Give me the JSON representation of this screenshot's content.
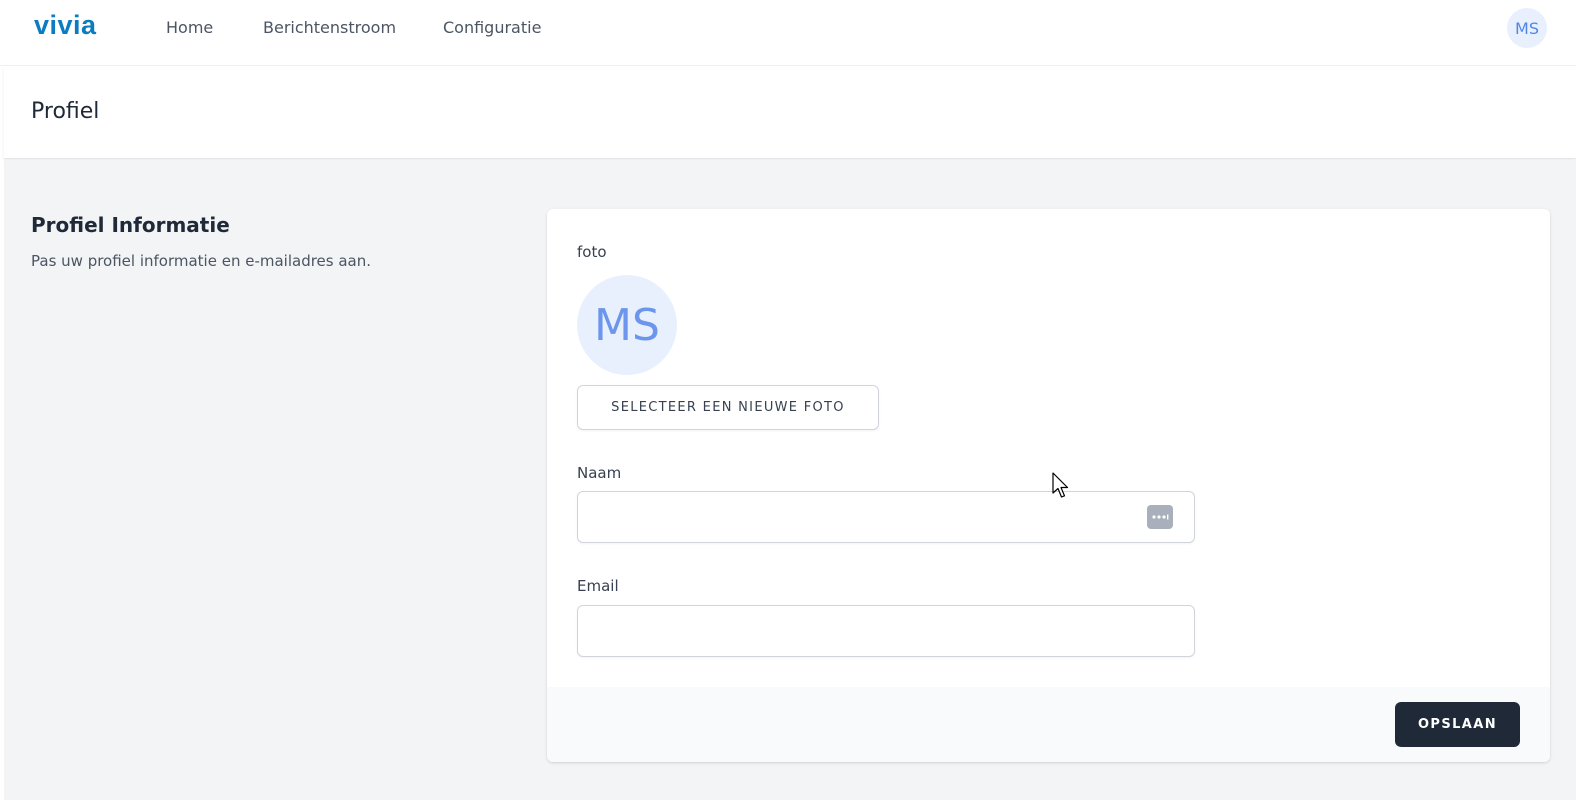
{
  "nav": {
    "logo": "vivia",
    "links": [
      "Home",
      "Berichtenstroom",
      "Configuratie"
    ],
    "avatar_initials": "MS"
  },
  "page": {
    "title": "Profiel"
  },
  "section": {
    "title": "Profiel Informatie",
    "description": "Pas uw profiel informatie en e-mailadres aan."
  },
  "form": {
    "photo_label": "foto",
    "photo_initials": "MS",
    "select_photo_button": "SELECTEER EEN NIEUWE FOTO",
    "name_label": "Naam",
    "name_value": "",
    "email_label": "Email",
    "email_value": "",
    "save_button": "OPSLAAN"
  },
  "colors": {
    "brand": "#0b7cc1",
    "avatar_bg": "#e8f0fe",
    "avatar_text": "#4f86e8",
    "primary_button": "#1f2937"
  }
}
